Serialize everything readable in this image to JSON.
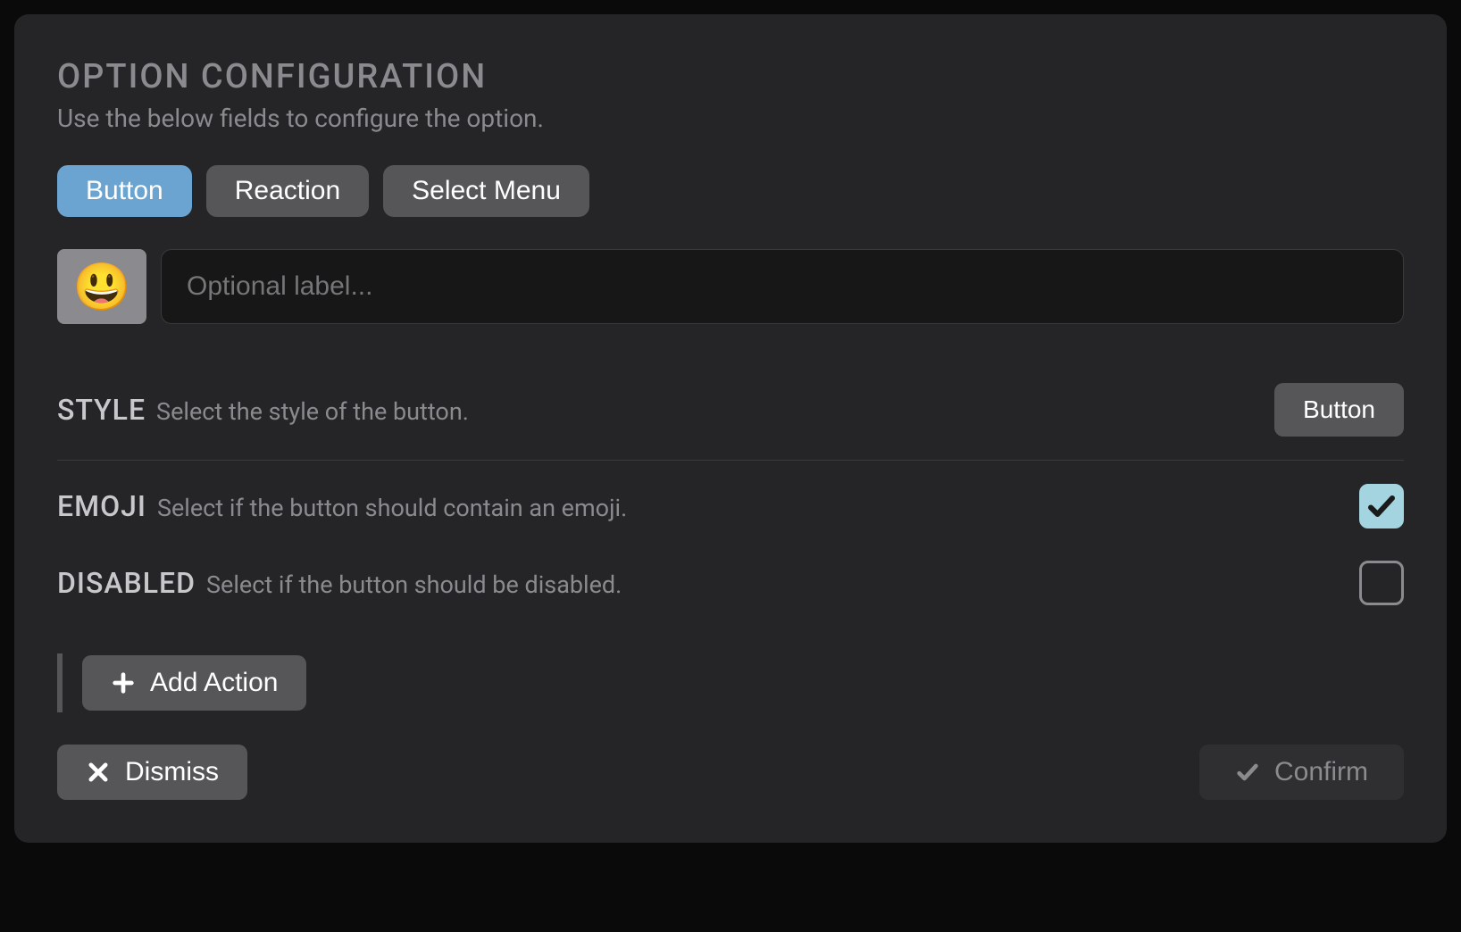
{
  "header": {
    "title": "OPTION CONFIGURATION",
    "subtitle": "Use the below fields to configure the option."
  },
  "tabs": [
    {
      "label": "Button",
      "active": true
    },
    {
      "label": "Reaction",
      "active": false
    },
    {
      "label": "Select Menu",
      "active": false
    }
  ],
  "emoji": "😃",
  "labelInput": {
    "value": "",
    "placeholder": "Optional label..."
  },
  "style": {
    "title": "STYLE",
    "desc": "Select the style of the button.",
    "value": "Button"
  },
  "emojiOption": {
    "title": "EMOJI",
    "desc": "Select if the button should contain an emoji.",
    "checked": true
  },
  "disabledOption": {
    "title": "DISABLED",
    "desc": "Select if the button should be disabled.",
    "checked": false
  },
  "addAction": "Add Action",
  "dismiss": "Dismiss",
  "confirm": "Confirm"
}
